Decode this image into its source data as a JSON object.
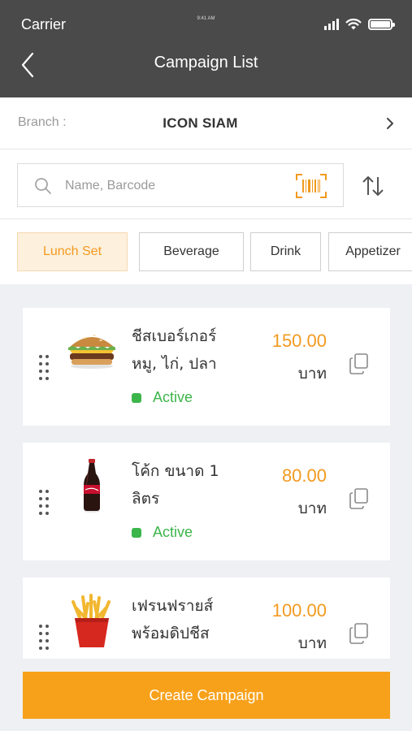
{
  "status_bar": {
    "carrier": "Carrier",
    "time": "9:41 AM"
  },
  "header": {
    "title": "Campaign List",
    "back_icon": "chevron-left-icon"
  },
  "branch": {
    "label": "Branch :",
    "value": "ICON SIAM",
    "chevron_icon": "chevron-right-icon"
  },
  "search": {
    "placeholder": "Name, Barcode",
    "value": "",
    "icon": "search-icon",
    "barcode_icon": "barcode-scan-icon",
    "sort_icon": "sort-icon"
  },
  "categories": [
    {
      "label": "Lunch Set",
      "active": true
    },
    {
      "label": "Beverage",
      "active": false
    },
    {
      "label": "Drink",
      "active": false
    },
    {
      "label": "Appetizer",
      "active": false
    }
  ],
  "items": [
    {
      "name_line1": "ชีสเบอร์เกอร์",
      "name_line2": "หมู, ไก่, ปลา",
      "price": "150.00",
      "unit": "บาท",
      "status": "Active",
      "image": "burger"
    },
    {
      "name_line1": "โค้ก ขนาด 1",
      "name_line2": "ลิตร",
      "price": "80.00",
      "unit": "บาท",
      "status": "Active",
      "image": "cola-bottle"
    },
    {
      "name_line1": "เฟรนฟรายส์",
      "name_line2": "พร้อมดิปชีส",
      "price": "100.00",
      "unit": "บาท",
      "status": "",
      "image": "french-fries"
    }
  ],
  "actions": {
    "create_label": "Create Campaign"
  },
  "colors": {
    "header_bg": "#4a4a4a",
    "accent": "#f29a1f",
    "active_green": "#3cb54a",
    "button_bg": "#f7a11a"
  }
}
